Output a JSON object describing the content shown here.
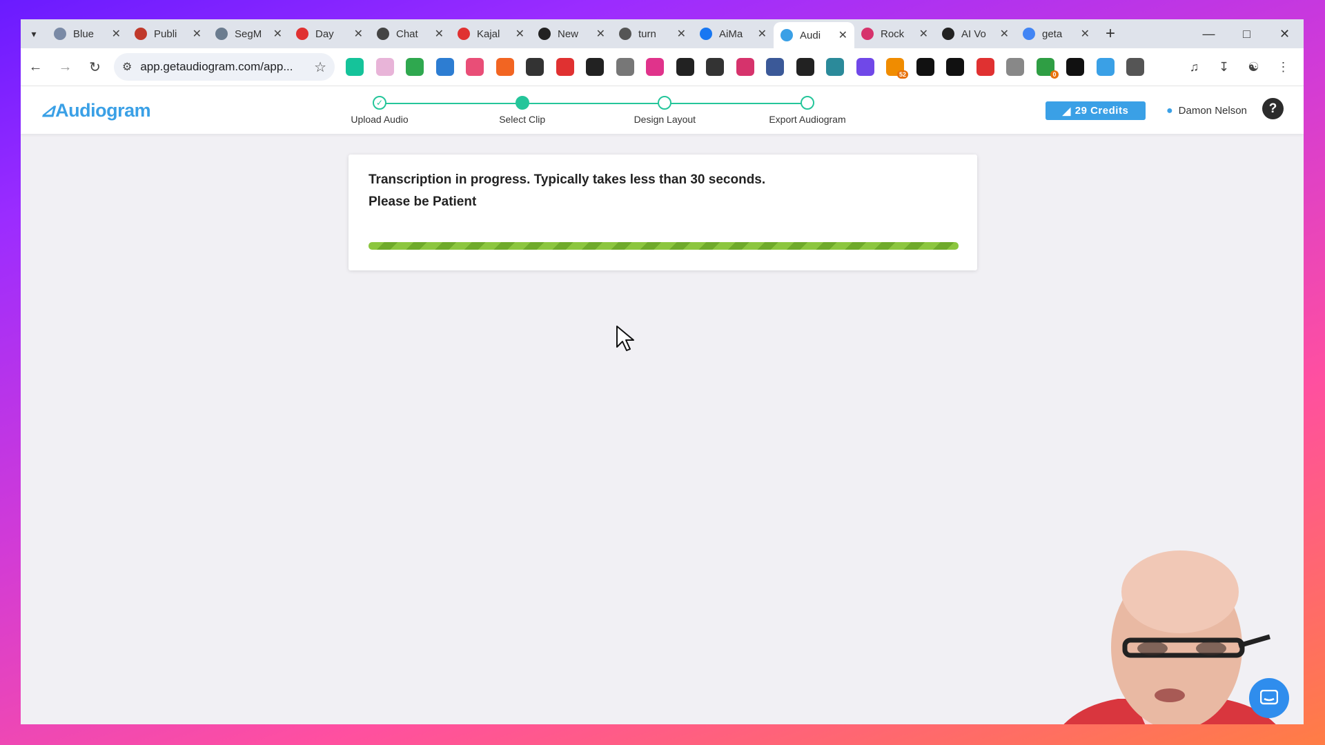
{
  "browser": {
    "tabs": [
      {
        "label": "Blue",
        "icon": "globe-icon",
        "color": "#7a8aa6"
      },
      {
        "label": "Publi",
        "icon": "heart-icon",
        "color": "#c0392b"
      },
      {
        "label": "SegM",
        "icon": "robot-icon",
        "color": "#6b7c8f"
      },
      {
        "label": "Day",
        "icon": "sk-icon",
        "color": "#e03131"
      },
      {
        "label": "Chat",
        "icon": "openai-icon",
        "color": "#444444"
      },
      {
        "label": "Kajal",
        "icon": "k-icon",
        "color": "#e03131"
      },
      {
        "label": "New",
        "icon": "github-icon",
        "color": "#222222"
      },
      {
        "label": "turn",
        "icon": "globe-icon",
        "color": "#555555"
      },
      {
        "label": "AiMa",
        "icon": "facebook-icon",
        "color": "#1877f2"
      },
      {
        "label": "Audi",
        "icon": "audiogram-icon",
        "color": "#3aa0e6",
        "active": true
      },
      {
        "label": "Rock",
        "icon": "rocket-icon",
        "color": "#d6336c"
      },
      {
        "label": "AI Vo",
        "icon": "pause-icon",
        "color": "#222222"
      },
      {
        "label": "geta",
        "icon": "google-icon",
        "color": "#4285f4"
      }
    ],
    "url": "app.getaudiogram.com/app...",
    "extensions": [
      {
        "name": "grammarly-icon",
        "color": "#15c39a"
      },
      {
        "name": "pinwheel-icon",
        "color": "#e8b4d8"
      },
      {
        "name": "screen-icon",
        "color": "#2fa84f"
      },
      {
        "name": "edge-icon",
        "color": "#2d7dd2"
      },
      {
        "name": "color-wheel-icon",
        "color": "#e94e77"
      },
      {
        "name": "rss-icon",
        "color": "#f26522"
      },
      {
        "name": "face-icon",
        "color": "#333333"
      },
      {
        "name": "record-icon",
        "color": "#e03131"
      },
      {
        "name": "r-icon",
        "color": "#222222"
      },
      {
        "name": "mic-icon",
        "color": "#777777"
      },
      {
        "name": "w-icon",
        "color": "#e0338b"
      },
      {
        "name": "notion-icon",
        "color": "#222222"
      },
      {
        "name": "sparkle-icon",
        "color": "#333333"
      },
      {
        "name": "rocket-icon",
        "color": "#d6336c"
      },
      {
        "name": "shield-icon",
        "color": "#3b5998"
      },
      {
        "name": "bolt-icon",
        "color": "#222222"
      },
      {
        "name": "grid-icon",
        "color": "#2b8a9a"
      },
      {
        "name": "camera-icon",
        "color": "#7048e8"
      },
      {
        "name": "badge-icon",
        "color": "#f08c00",
        "badge": "52"
      },
      {
        "name": "square-icon",
        "color": "#111111"
      },
      {
        "name": "l-icon",
        "color": "#111111"
      },
      {
        "name": "pdf-icon",
        "color": "#e03131"
      },
      {
        "name": "code-icon",
        "color": "#888888"
      },
      {
        "name": "chrome-badge-icon",
        "color": "#2f9e44",
        "badge": "0"
      },
      {
        "name": "x-icon",
        "color": "#111111"
      },
      {
        "name": "search-ext-icon",
        "color": "#3aa0e6"
      },
      {
        "name": "puzzle-icon",
        "color": "#555555"
      }
    ]
  },
  "app": {
    "logo": "Audiogram",
    "steps": [
      {
        "label": "Upload Audio",
        "state": "done"
      },
      {
        "label": "Select Clip",
        "state": "current"
      },
      {
        "label": "Design Layout",
        "state": "pending"
      },
      {
        "label": "Export Audiogram",
        "state": "pending"
      }
    ],
    "credits": "29 Credits",
    "user_name": "Damon Nelson",
    "help": "?"
  },
  "card": {
    "line1": "Transcription in progress. Typically takes less than 30 seconds.",
    "line2": "Please be Patient",
    "progress": 1.0
  },
  "colors": {
    "accent": "#3aa0e6",
    "step": "#24c59a",
    "progress": "#8cc63f"
  }
}
